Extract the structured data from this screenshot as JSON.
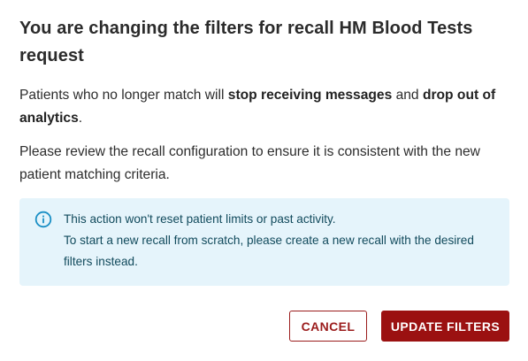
{
  "dialog": {
    "title": "You are changing the filters for recall HM Blood Tests request",
    "paragraph1": {
      "part1": "Patients who no longer match will ",
      "bold1": "stop receiving messages",
      "part2": " and ",
      "bold2": "drop out of analytics",
      "part3": "."
    },
    "paragraph2": "Please review the recall configuration to ensure it is consistent with the new patient matching criteria.",
    "info": {
      "icon": "info-circle-icon",
      "line1": "This action won't reset patient limits or past activity.",
      "line2": "To start a new recall from scratch, please create a new recall with the desired filters instead."
    },
    "buttons": {
      "cancel": "CANCEL",
      "update": "UPDATE FILTERS"
    }
  },
  "colors": {
    "primary": "#9b1111",
    "info_background": "#e5f4fb",
    "info_text": "#114a5c",
    "info_icon": "#1a8fc5"
  }
}
